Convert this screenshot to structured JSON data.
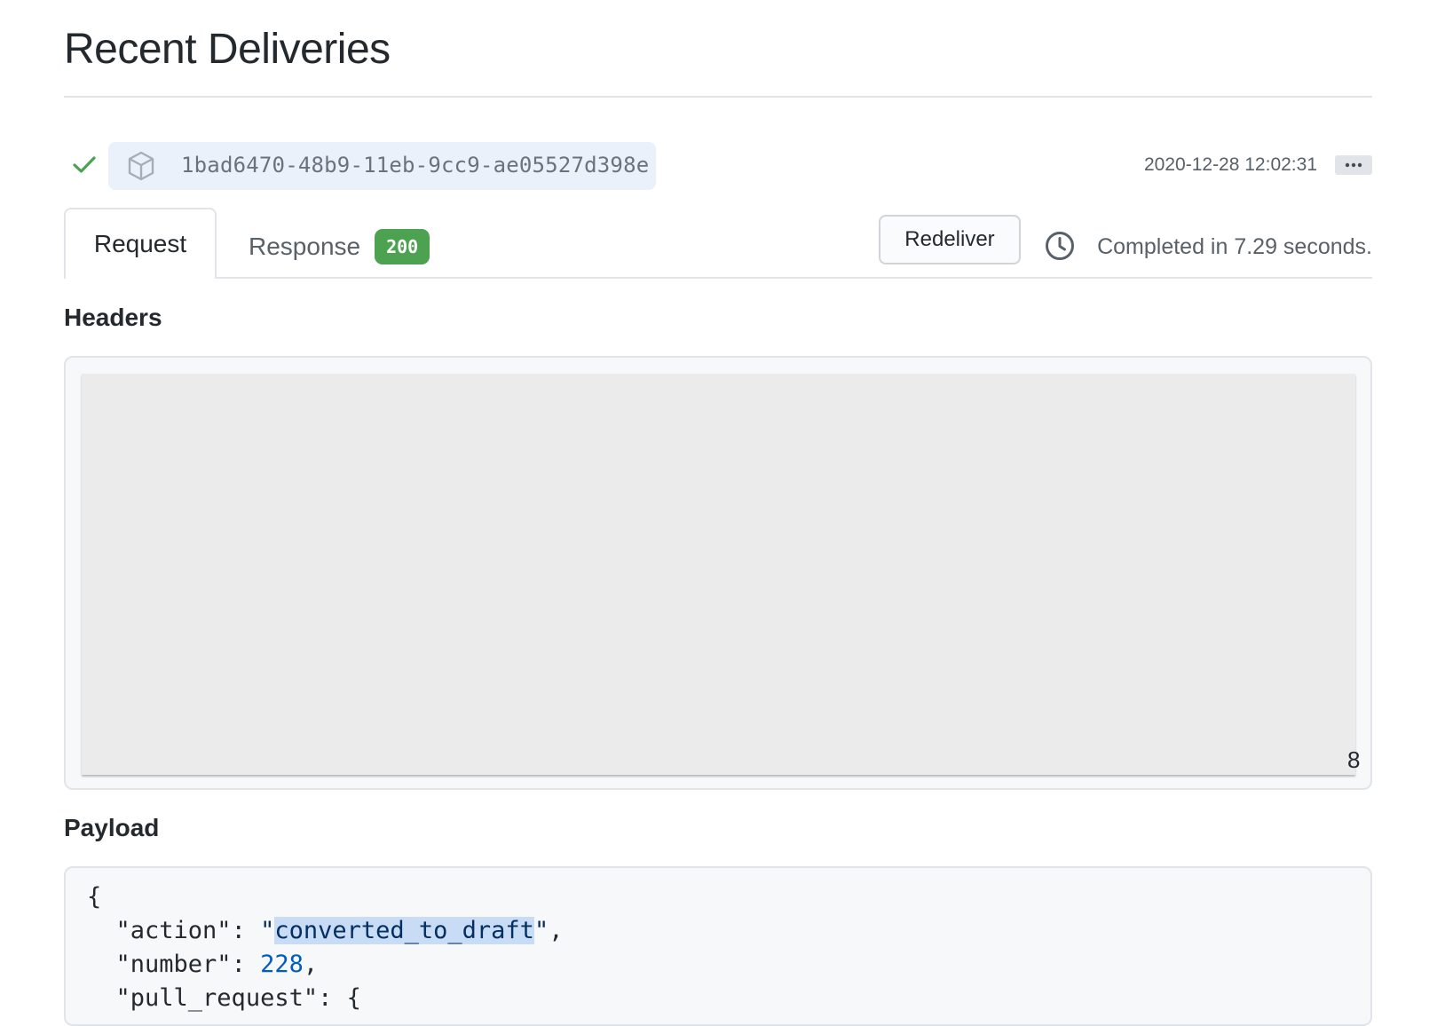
{
  "page": {
    "title": "Recent Deliveries"
  },
  "delivery": {
    "status": "success",
    "guid": "1bad6470-48b9-11eb-9cc9-ae05527d398e",
    "timestamp": "2020-12-28 12:02:31",
    "more_label": "···"
  },
  "tabs": {
    "request_label": "Request",
    "response_label": "Response",
    "response_code": "200"
  },
  "actions": {
    "redeliver_label": "Redeliver",
    "completed_text": "Completed in 7.29 seconds."
  },
  "headers": {
    "title": "Headers",
    "trailing_char": "8"
  },
  "payload": {
    "title": "Payload",
    "open_brace": "{",
    "action_key": "\"action\"",
    "action_value": "converted_to_draft",
    "number_key": "\"number\"",
    "number_value": "228",
    "pull_request_key": "\"pull_request\"",
    "pull_request_open": "{"
  },
  "colors": {
    "success_green": "#4ca250",
    "guid_pill_bg": "#eaf1fb",
    "selection_bg": "#c8dcf5"
  }
}
